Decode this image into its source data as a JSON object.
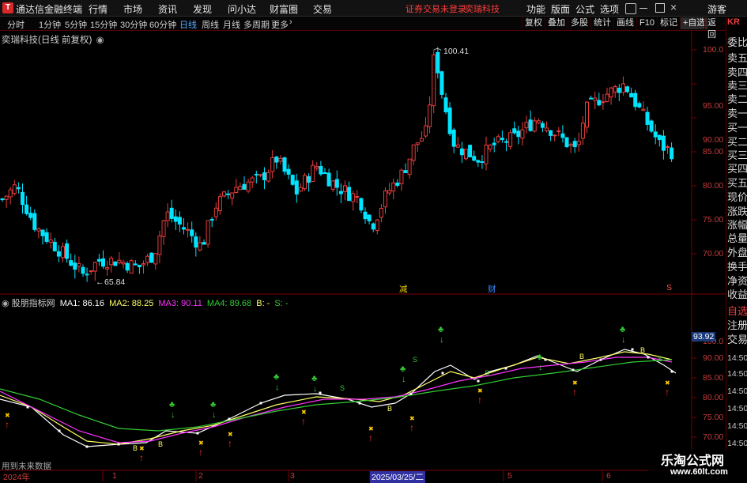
{
  "app": {
    "title": "通达信金融终端",
    "logo": "T"
  },
  "menu": [
    "行情",
    "市场",
    "资讯",
    "发现",
    "问小达",
    "财富圈",
    "交易"
  ],
  "status": {
    "trade_notice": "证券交易未登录",
    "stock": "奕瑞科技"
  },
  "right_menu": [
    "功能",
    "版面",
    "公式",
    "选项"
  ],
  "user": "游客",
  "periods": [
    "分时",
    "1分钟",
    "5分钟",
    "15分钟",
    "30分钟",
    "60分钟",
    "日线",
    "周线",
    "月线",
    "多周期",
    "更多"
  ],
  "active_period": "日线",
  "toolbar": [
    "复权",
    "叠加",
    "多股",
    "统计",
    "画线",
    "F10",
    "标记",
    "+自选",
    "返回"
  ],
  "right_panel": {
    "badge": "KR",
    "items": [
      "委比",
      "卖五",
      "卖四",
      "卖三",
      "卖二",
      "卖一",
      "买一",
      "买二",
      "买三",
      "买四",
      "买五",
      "现价",
      "涨跌",
      "涨幅",
      "总量",
      "外盘",
      "换手",
      "净资",
      "收益",
      "自选",
      "注册",
      "交易"
    ]
  },
  "price_chart": {
    "title": "奕瑞科技(日线 前复权)",
    "yticks": [
      "100.0",
      "95.00",
      "90.00",
      "85.00",
      "80.00",
      "75.00",
      "70.00"
    ],
    "high_label": "100.41",
    "low_label": "65.84",
    "markers": [
      "减",
      "财",
      "S"
    ]
  },
  "indicator": {
    "name": "股朋指标网",
    "values": [
      {
        "label": "MA1: 86.16",
        "color": "#ffffff"
      },
      {
        "label": "MA2: 88.25",
        "color": "#ffff66"
      },
      {
        "label": "MA3: 90.11",
        "color": "#ff33ff"
      },
      {
        "label": "MA4: 89.68",
        "color": "#33cc33"
      },
      {
        "label": "B: -",
        "color": "#ffff66"
      },
      {
        "label": "S: -",
        "color": "#33cc33"
      }
    ],
    "yticks": [
      "100.0",
      "90.00",
      "85.00",
      "80.00",
      "75.00",
      "70.00"
    ],
    "current_value": "93.92",
    "right_time_labels": [
      "14:50",
      "14:50",
      "14:50",
      "14:50",
      "14:50",
      "14:50"
    ],
    "future_label": "用到未来数据"
  },
  "x_axis": {
    "labels": [
      "2024年",
      "1",
      "2",
      "3",
      "5",
      "6"
    ],
    "cursor_label": "2025/03/25/二"
  },
  "watermark": {
    "name": "乐淘公式网",
    "url": "www.60lt.com"
  },
  "colors": {
    "up": "#e83c3c",
    "down": "#00e5ff",
    "axis": "#c83c3c",
    "grid": "#5a0000",
    "active": "#54a8ff"
  }
}
